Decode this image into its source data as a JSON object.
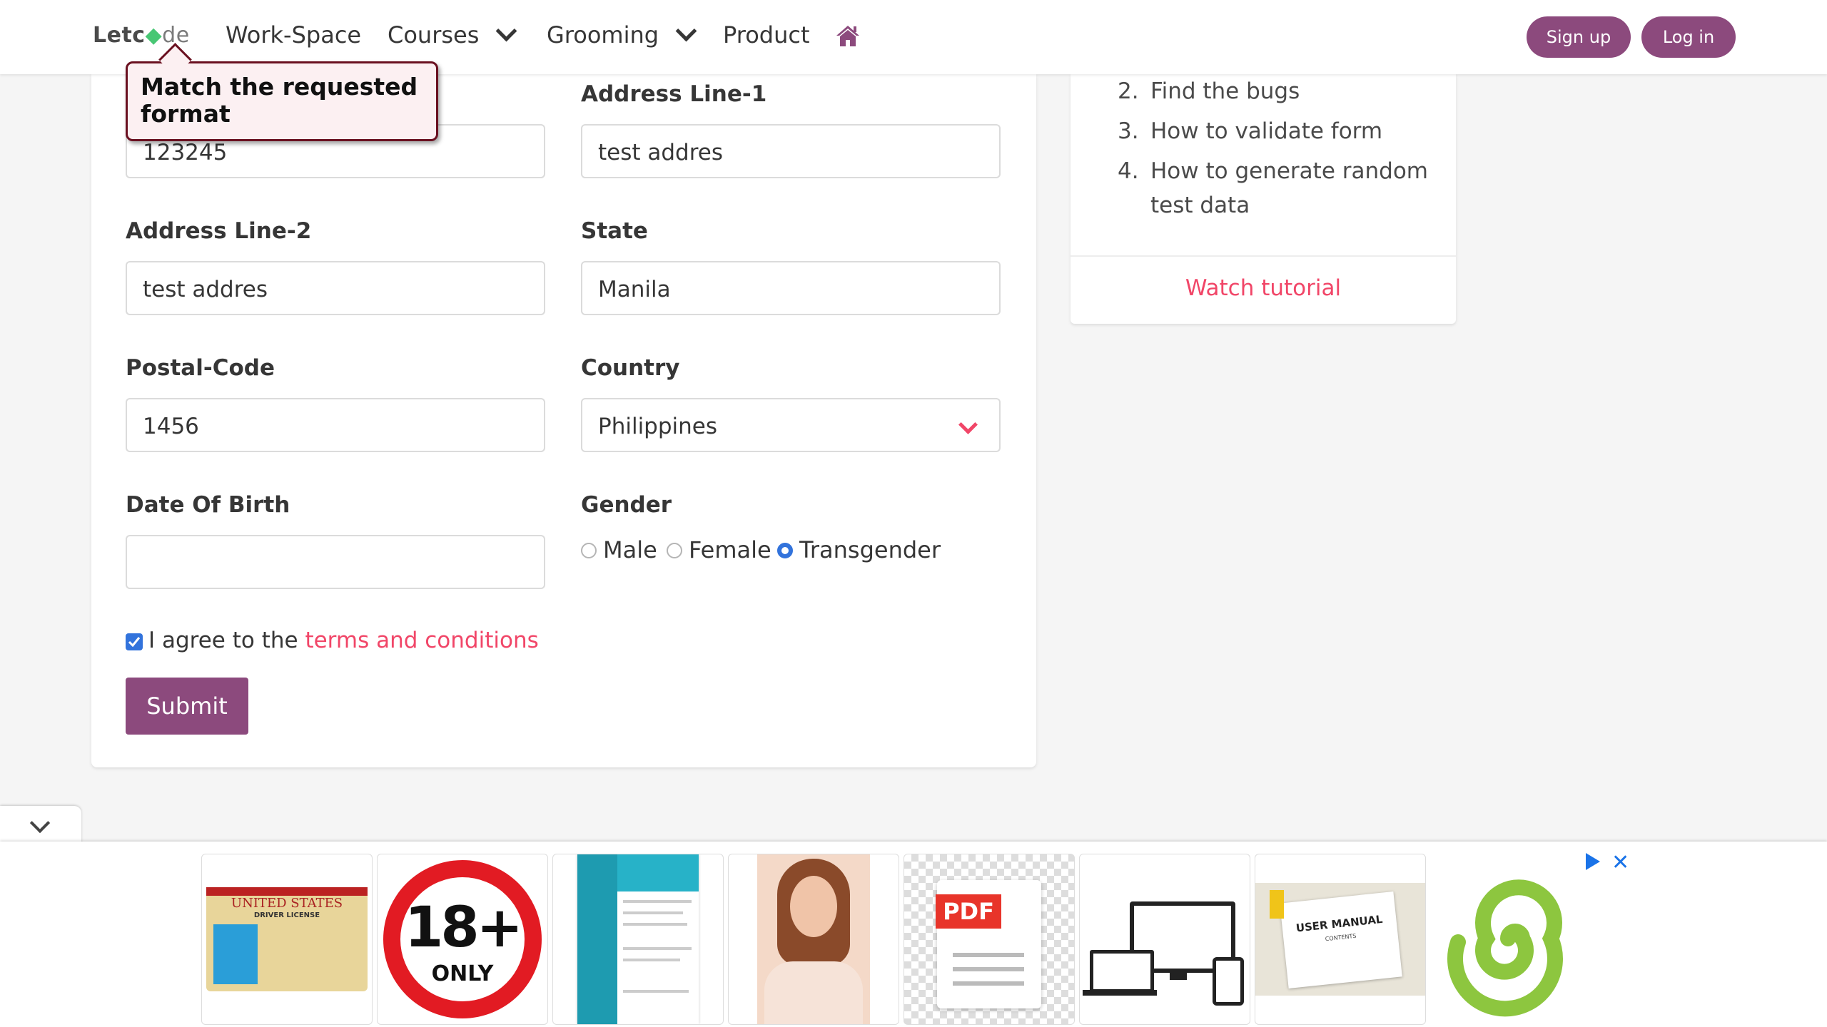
{
  "nav": {
    "logo_a": "Letc",
    "logo_b": "de",
    "items": [
      "Work-Space",
      "Courses",
      "Grooming",
      "Product"
    ],
    "signup": "Sign up",
    "login": "Log in"
  },
  "form": {
    "tooltip": "Match the requested format",
    "field1_value": "123245",
    "address1_label": "Address Line-1",
    "address1_value": "test addres",
    "address2_label": "Address Line-2",
    "address2_value": "test addres",
    "state_label": "State",
    "state_value": "Manila",
    "postal_label": "Postal-Code",
    "postal_value": "1456",
    "country_label": "Country",
    "country_value": "Philippines",
    "dob_label": "Date Of Birth",
    "dob_value": "",
    "gender_label": "Gender",
    "gender_options": [
      "Male",
      "Female",
      "Transgender"
    ],
    "gender_selected": "Transgender",
    "agree_text": "I agree to the",
    "terms_link": "terms and conditions",
    "agree_checked": true,
    "submit": "Submit"
  },
  "side": {
    "items": [
      {
        "num": "2.",
        "text": "Find the bugs"
      },
      {
        "num": "3.",
        "text": "How to validate form"
      },
      {
        "num": "4.",
        "text": "How to generate random test data"
      }
    ],
    "watch": "Watch tutorial"
  },
  "ads": {
    "tiles": [
      "driver-license-ad",
      "18-plus-ad",
      "resume-template-ad",
      "woman-photo-ad",
      "pdf-document-ad",
      "devices-ad",
      "user-manual-ad",
      "green-spiral-ad"
    ],
    "license_text": "UNITED STATES",
    "license_sub": "DRIVER LICENSE",
    "age_text": "18+",
    "age_sub": "ONLY",
    "pdf_text": "PDF",
    "manual_text": "USER MANUAL",
    "manual_sub": "CONTENTS"
  },
  "colors": {
    "brand": "#8c4a7d",
    "accent": "#f14668",
    "link": "#3273dc"
  }
}
